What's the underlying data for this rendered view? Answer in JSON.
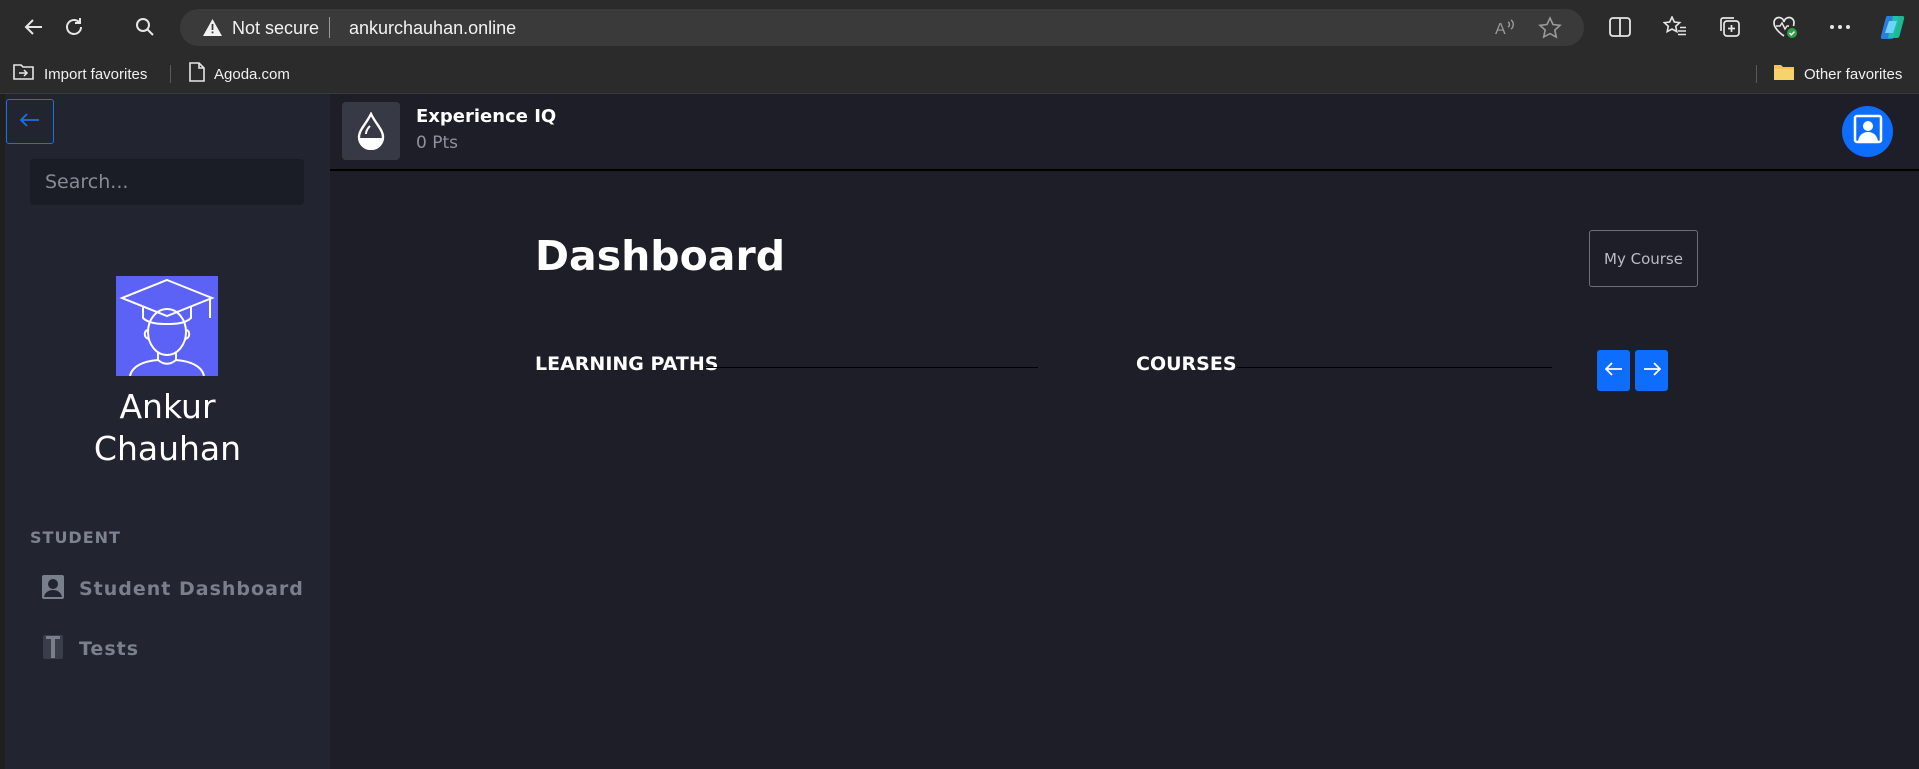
{
  "browser": {
    "address": {
      "security_label": "Not secure",
      "url": "ankurchauhan.online"
    },
    "bookmarks": [
      {
        "label": "Import favorites",
        "icon": "import-folder-icon"
      },
      {
        "label": "Agoda.com",
        "icon": "page-icon"
      }
    ],
    "other_favorites": "Other favorites"
  },
  "sidebar": {
    "search_placeholder": "Search...",
    "profile_name": "Ankur Chauhan",
    "section_label": "STUDENT",
    "items": [
      {
        "label": "Student Dashboard",
        "icon": "user-card-icon"
      },
      {
        "label": "Tests",
        "icon": "test-tube-icon"
      }
    ]
  },
  "header": {
    "brand_title": "Experience IQ",
    "points": "0 Pts"
  },
  "main": {
    "title": "Dashboard",
    "my_course_label": "My Course",
    "learning_paths_label": "LEARNING PATHS",
    "courses_label": "COURSES"
  },
  "colors": {
    "accent": "#0d6efd",
    "avatar_tile": "#5b62f5",
    "app_bg": "#1e1e28",
    "sidebar_bg": "#222530"
  }
}
